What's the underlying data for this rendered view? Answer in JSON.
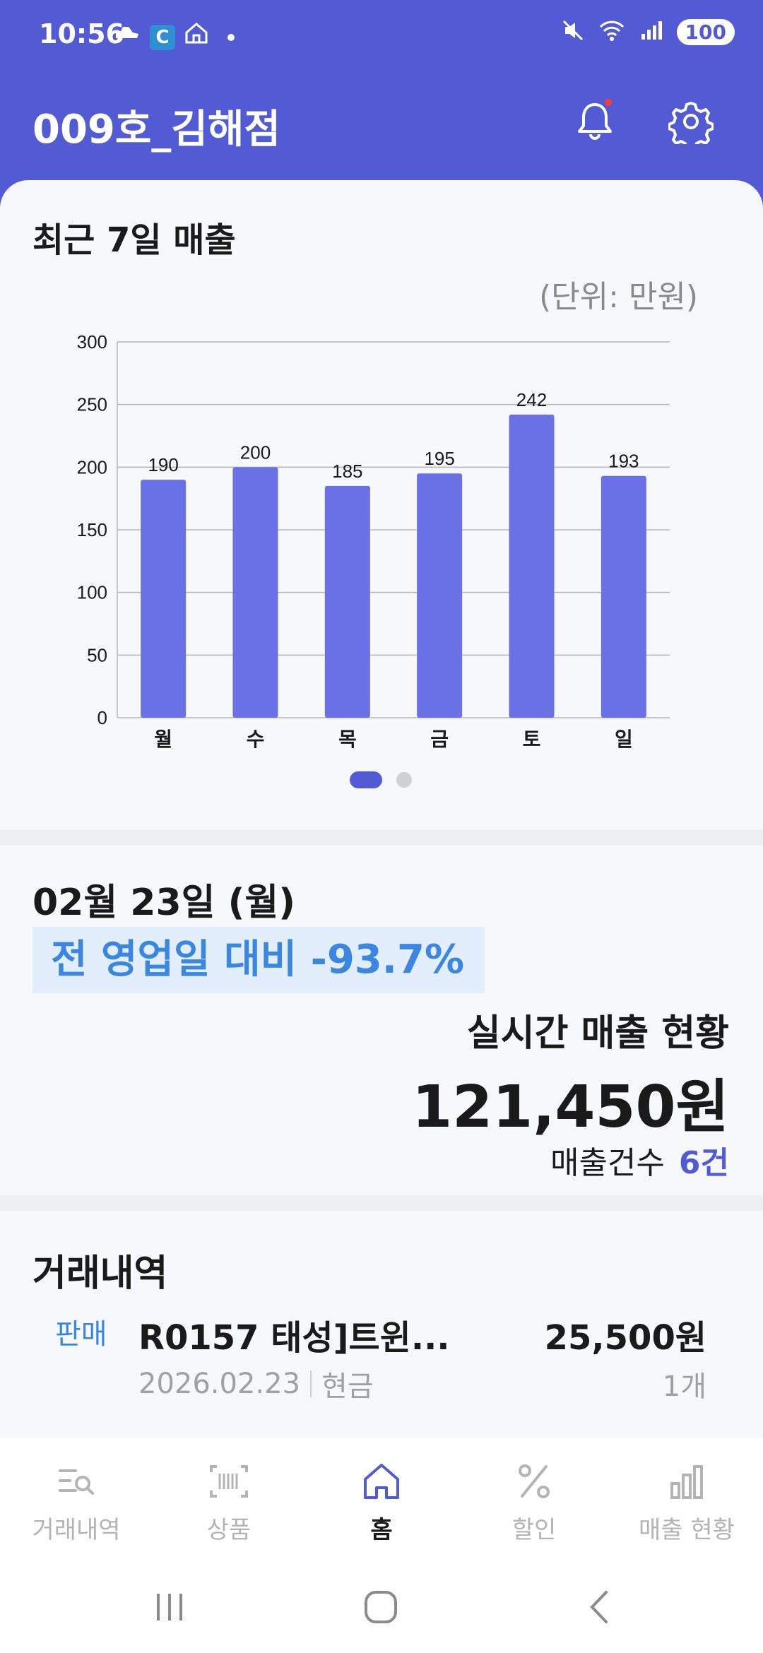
{
  "status_bar": {
    "time": "10:56",
    "battery": "100"
  },
  "header": {
    "title": "009호_김해점"
  },
  "chart_card": {
    "title": "최근 7일 매출",
    "unit": "(단위: 만원)"
  },
  "chart_data": {
    "type": "bar",
    "categories": [
      "월",
      "수",
      "목",
      "금",
      "토",
      "일"
    ],
    "values": [
      190,
      200,
      185,
      195,
      242,
      193
    ],
    "ylim": [
      0,
      300
    ],
    "yticks": [
      0,
      50,
      100,
      150,
      200,
      250,
      300
    ],
    "grid": true,
    "bar_color": "#6a70e6",
    "title": "최근 7일 매출",
    "xlabel": "",
    "ylabel": "(단위: 만원)"
  },
  "sales": {
    "date": "02월 23일 (월)",
    "compare": "전 영업일 대비  -93.7%",
    "realtime_label": "실시간 매출 현황",
    "realtime_amount": "121,450원",
    "count_label": "매출건수",
    "count_value": "6건"
  },
  "transactions": {
    "title": "거래내역",
    "items": [
      {
        "type": "판매",
        "name": "R0157 태성]트윈...",
        "amount": "25,500원",
        "date": "2026.02.23",
        "payment": "현금",
        "qty": "1개"
      }
    ]
  },
  "nav": {
    "items": [
      {
        "label": "거래내역",
        "icon": "list-search-icon"
      },
      {
        "label": "상품",
        "icon": "barcode-icon"
      },
      {
        "label": "홈",
        "icon": "home-icon"
      },
      {
        "label": "할인",
        "icon": "percent-icon"
      },
      {
        "label": "매출 현황",
        "icon": "bar-chart-icon"
      }
    ]
  },
  "colors": {
    "primary": "#525bd4",
    "accent": "#3a86e1"
  }
}
